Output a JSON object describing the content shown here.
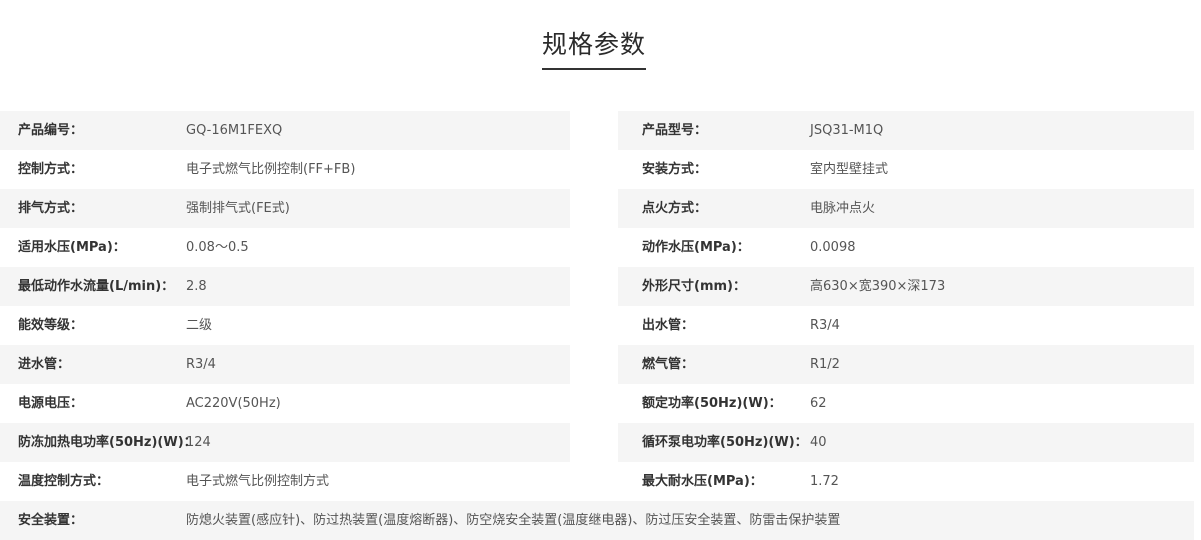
{
  "section": {
    "title": "规格参数"
  },
  "specs": {
    "rows": [
      {
        "left_label": "产品编号：",
        "left_value": "GQ-16M1FEXQ",
        "right_label": "产品型号：",
        "right_value": "JSQ31-M1Q"
      },
      {
        "left_label": "控制方式：",
        "left_value": "电子式燃气比例控制(FF+FB)",
        "right_label": "安装方式：",
        "right_value": "室内型壁挂式"
      },
      {
        "left_label": "排气方式：",
        "left_value": "强制排气式(FE式)",
        "right_label": "点火方式：",
        "right_value": "电脉冲点火"
      },
      {
        "left_label": "适用水压(MPa)：",
        "left_value": "0.08～0.5",
        "right_label": "动作水压(MPa)：",
        "right_value": "0.0098"
      },
      {
        "left_label": "最低动作水流量(L/min)：",
        "left_value": "2.8",
        "right_label": "外形尺寸(mm)：",
        "right_value": "高630×宽390×深173"
      },
      {
        "left_label": "能效等级：",
        "left_value": "二级",
        "right_label": "出水管：",
        "right_value": "R3/4"
      },
      {
        "left_label": "进水管：",
        "left_value": "R3/4",
        "right_label": "燃气管：",
        "right_value": "R1/2"
      },
      {
        "left_label": "电源电压：",
        "left_value": "AC220V(50Hz)",
        "right_label": "额定功率(50Hz)(W)：",
        "right_value": "62"
      },
      {
        "left_label": "防冻加热电功率(50Hz)(W)：",
        "left_value": "124",
        "right_label": "循环泵电功率(50Hz)(W)：",
        "right_value": "40"
      },
      {
        "left_label": "温度控制方式：",
        "left_value": "电子式燃气比例控制方式",
        "right_label": "最大耐水压(MPa)：",
        "right_value": "1.72"
      }
    ],
    "full_row": {
      "label": "安全装置：",
      "value": "防熄火装置(感应针)、防过热装置(温度熔断器)、防空烧安全装置(温度继电器)、防过压安全装置、防雷击保护装置"
    }
  }
}
